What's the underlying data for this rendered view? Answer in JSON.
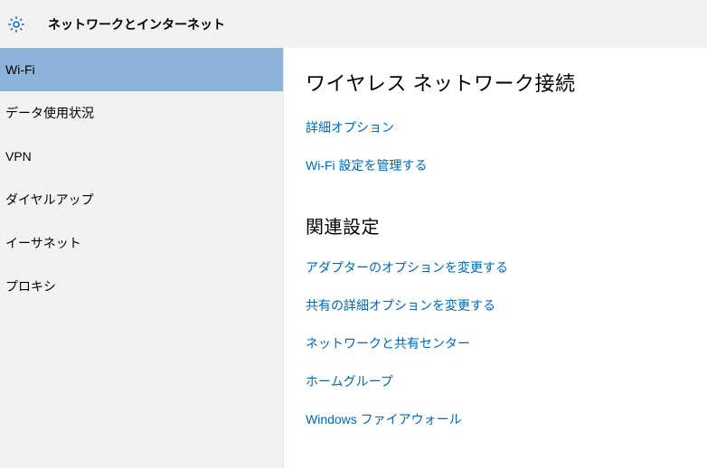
{
  "header": {
    "title": "ネットワークとインターネット"
  },
  "sidebar": {
    "items": [
      {
        "label": "Wi-Fi",
        "selected": true
      },
      {
        "label": "データ使用状況",
        "selected": false
      },
      {
        "label": "VPN",
        "selected": false
      },
      {
        "label": "ダイヤルアップ",
        "selected": false
      },
      {
        "label": "イーサネット",
        "selected": false
      },
      {
        "label": "プロキシ",
        "selected": false
      }
    ]
  },
  "main": {
    "section1": {
      "heading": "ワイヤレス ネットワーク接続",
      "links": [
        "詳細オプション",
        "Wi-Fi 設定を管理する"
      ]
    },
    "section2": {
      "heading": "関連設定",
      "links": [
        "アダプターのオプションを変更する",
        "共有の詳細オプションを変更する",
        "ネットワークと共有センター",
        "ホームグループ",
        "Windows ファイアウォール"
      ]
    }
  },
  "colors": {
    "accent_link": "#0067b8",
    "sidebar_selected": "#8cb3d9",
    "panel_bg": "#f2f2f2"
  }
}
